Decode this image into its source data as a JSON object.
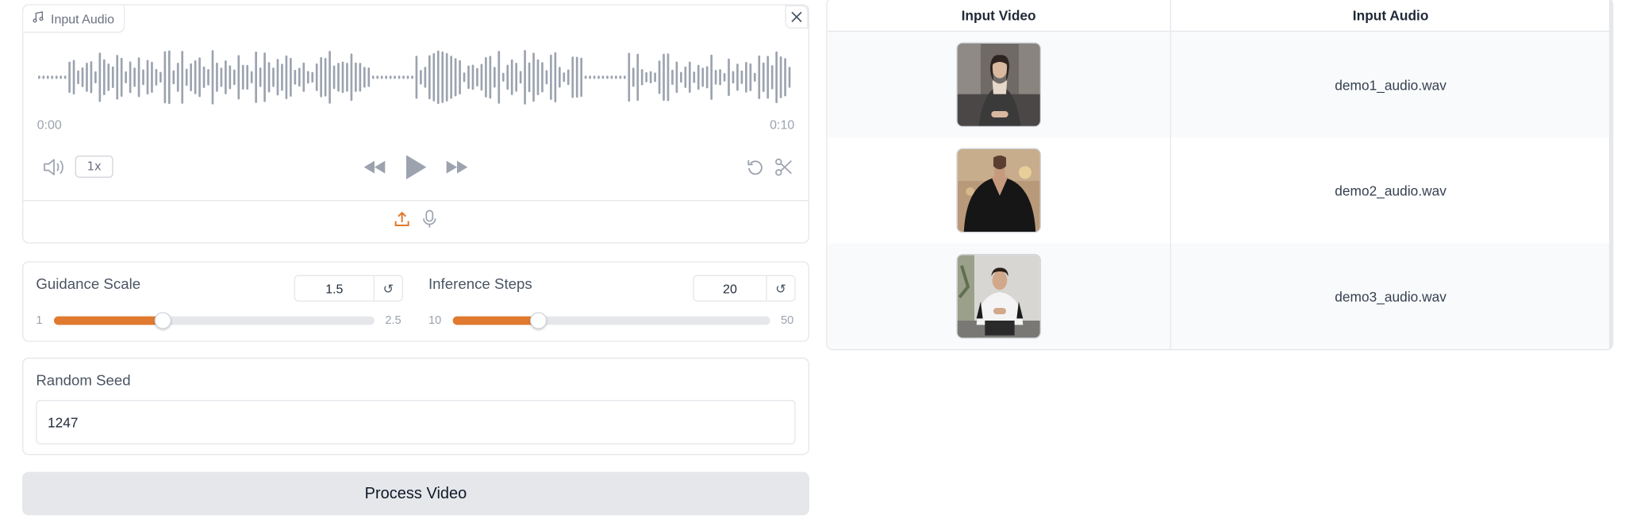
{
  "audio": {
    "label": "Input Audio",
    "icon": "music-note-icon",
    "time_start": "0:00",
    "time_end": "0:10",
    "playback_rate": "1x",
    "accent_color": "#e07a2e"
  },
  "sliders": {
    "guidance": {
      "label": "Guidance Scale",
      "value": "1.5",
      "min": "1",
      "max": "2.5",
      "fraction": 0.34
    },
    "steps": {
      "label": "Inference Steps",
      "value": "20",
      "min": "10",
      "max": "50",
      "fraction": 0.27
    }
  },
  "seed": {
    "label": "Random Seed",
    "value": "1247"
  },
  "process_button": {
    "label": "Process Video"
  },
  "examples": {
    "headers": [
      "Input Video",
      "Input Audio"
    ],
    "rows": [
      {
        "video": "demo1 thumbnail",
        "audio": "demo1_audio.wav"
      },
      {
        "video": "demo2 thumbnail",
        "audio": "demo2_audio.wav"
      },
      {
        "video": "demo3 thumbnail",
        "audio": "demo3_audio.wav"
      }
    ]
  }
}
